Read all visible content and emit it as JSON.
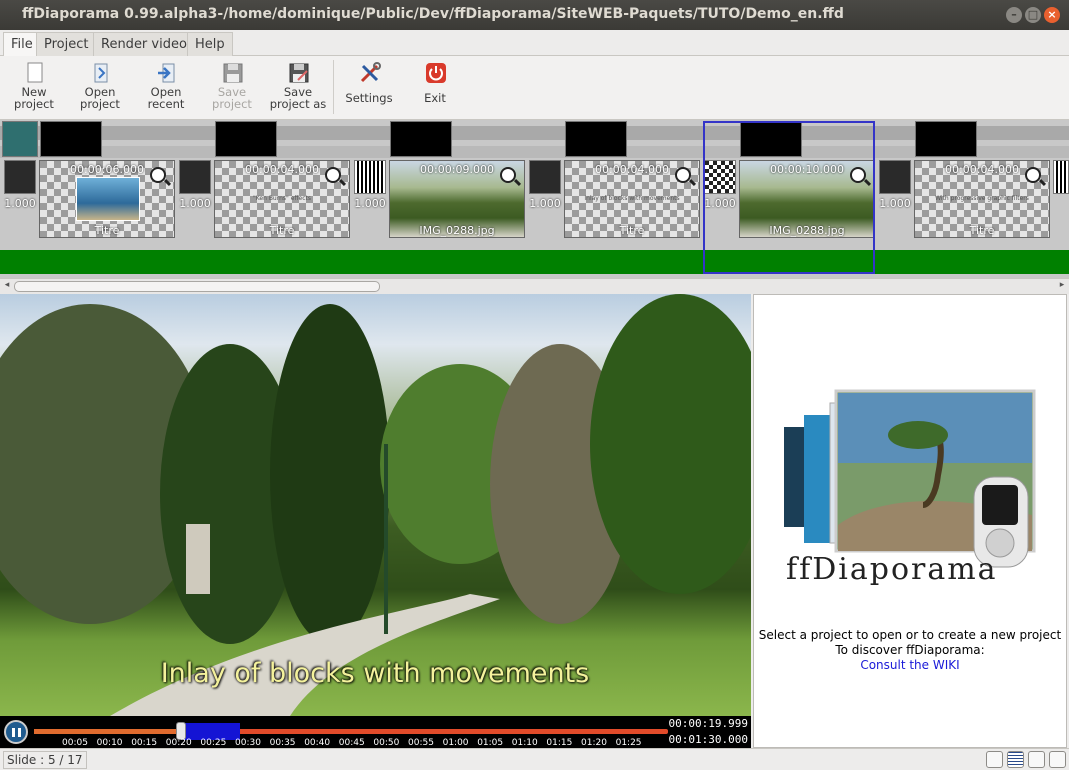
{
  "window": {
    "title": "ffDiaporama 0.99.alpha3-/home/dominique/Public/Dev/ffDiaporama/SiteWEB-Paquets/TUTO/Demo_en.ffd",
    "controls": [
      "minimize",
      "maximize",
      "close"
    ]
  },
  "menu": {
    "tabs": [
      "File",
      "Project",
      "Render video",
      "Help"
    ],
    "active": "File"
  },
  "toolbar": {
    "new_project": "New project",
    "open_project": "Open project",
    "open_recent": "Open recent",
    "save_project": "Save project",
    "save_project_as": "Save project as",
    "settings": "Settings",
    "exit": "Exit"
  },
  "timeline": {
    "transitions": [
      "1.000",
      "1.000",
      "1.000",
      "1.000",
      "1.000",
      "1.000"
    ],
    "slides": [
      {
        "duration": "00:00:06.000",
        "name": "Titre",
        "caption": ""
      },
      {
        "duration": "00:00:04.000",
        "name": "Titre",
        "caption": "\"Ken Burns\" effects"
      },
      {
        "duration": "00:00:09.000",
        "name": "IMG_0288.jpg",
        "caption": ""
      },
      {
        "duration": "00:00:04.000",
        "name": "Titre",
        "caption": "Inlay of blocks with movements"
      },
      {
        "duration": "00:00:10.000",
        "name": "IMG_0288.jpg",
        "caption": ""
      },
      {
        "duration": "00:00:04.000",
        "name": "Titre",
        "caption": "With progressive graphic filters"
      }
    ],
    "selected_index": 4
  },
  "preview": {
    "caption": "Inlay of blocks with movements",
    "progress_fraction": 0.222,
    "ticks": [
      "00:05",
      "00:10",
      "00:15",
      "00:20",
      "00:25",
      "00:30",
      "00:35",
      "00:40",
      "00:45",
      "00:50",
      "00:55",
      "01:00",
      "01:05",
      "01:10",
      "01:15",
      "01:20",
      "01:25"
    ],
    "current_time": "00:00:19.999",
    "total_time": "00:01:30.000"
  },
  "right_panel": {
    "logo_text": "ffDiaporama",
    "line1": "Select a project to open or to create a new project",
    "line2": "To discover ffDiaporama:",
    "link": "Consult the WIKI"
  },
  "status": {
    "slide": "Slide : 5 / 17"
  },
  "colors": {
    "timeline_green": "#008000",
    "selection_blue": "#3434c8",
    "caption_yellow": "#f4f29c",
    "link_blue": "#1a1ad8"
  }
}
